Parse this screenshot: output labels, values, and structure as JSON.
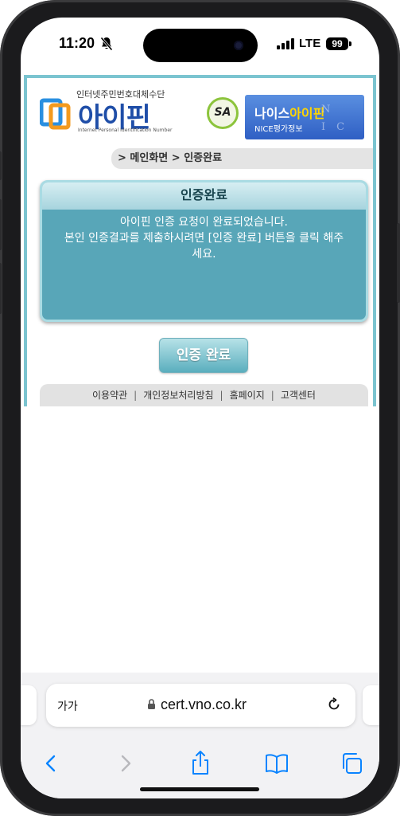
{
  "status_bar": {
    "time": "11:20",
    "network": "LTE",
    "battery": "99"
  },
  "header": {
    "logo_subtitle": "인터넷주민번호대체수단",
    "logo_name": "아이핀",
    "logo_english": "Internet Personal Identification Number",
    "sa_badge": "SA",
    "nice_title_prefix": "나이스",
    "nice_title_accent": "아이핀",
    "nice_subtitle": "NICE평가정보",
    "nice_letters": "NICE"
  },
  "breadcrumb": {
    "text": "> 메인화면 > 인증완료"
  },
  "panel": {
    "title": "인증완료",
    "line1": "아이핀 인증 요청이 완료되었습니다.",
    "line2": "본인 인증결과를 제출하시려면 [인증 완료] 버튼을 클릭 해주세요."
  },
  "confirm_button": "인증 완료",
  "footer": {
    "links": [
      "이용약관",
      "개인정보처리방침",
      "홈페이지",
      "고객센터"
    ],
    "separator": "|"
  },
  "browser": {
    "text_size_label": "가가",
    "url": "cert.vno.co.kr"
  },
  "colors": {
    "panel_body": "#58a6b8",
    "panel_header": "#a7d4de",
    "frame_accent": "#7bc4d0",
    "logo_blue": "#1f4ea8",
    "ios_blue": "#0a84ff"
  }
}
